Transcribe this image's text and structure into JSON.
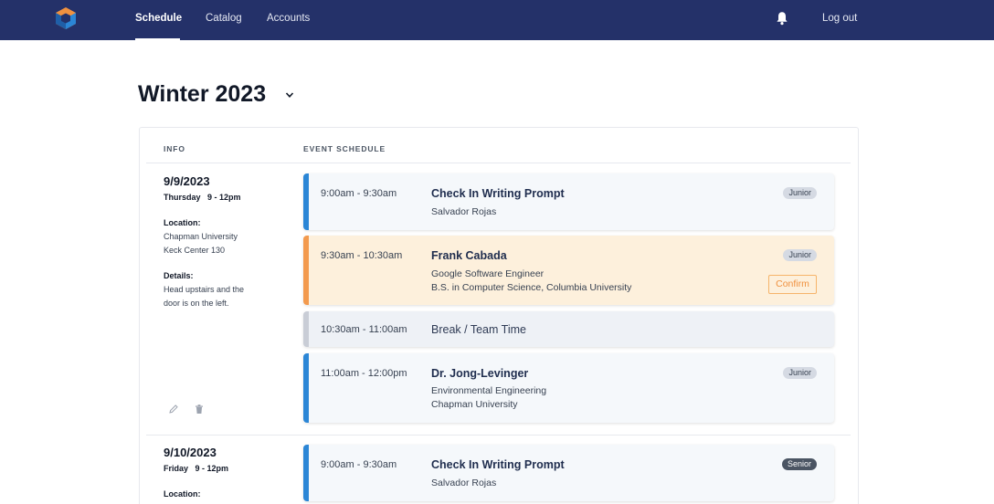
{
  "nav": {
    "logo": "cube-logo",
    "links": [
      "Schedule",
      "Catalog",
      "Accounts"
    ],
    "active": "Schedule",
    "logout": "Log out"
  },
  "title": "Winter 2023",
  "columns": {
    "info": "INFO",
    "schedule": "EVENT SCHEDULE"
  },
  "days": [
    {
      "date": "9/9/2023",
      "weekday_time": "Thursday   9 - 12pm",
      "location_label": "Location:",
      "location_lines": [
        "Chapman University",
        "Keck Center 130"
      ],
      "details_label": "Details:",
      "details_lines": [
        "Head upstairs and the",
        "door is on the left."
      ],
      "events": [
        {
          "time": "9:00am - 9:30am",
          "title": "Check In Writing Prompt",
          "lines": [
            "Salvador Rojas"
          ],
          "badge": "Junior"
        },
        {
          "time": "9:30am - 10:30am",
          "title": "Frank Cabada",
          "lines": [
            "Google Software Engineer",
            "B.S. in Computer Science, Columbia University"
          ],
          "badge": "Junior",
          "action": "Confirm"
        },
        {
          "time": "10:30am - 11:00am",
          "title": "Break / Team Time"
        },
        {
          "time": "11:00am - 12:00pm",
          "title": "Dr. Jong-Levinger",
          "lines": [
            "Environmental Engineering",
            "Chapman University"
          ],
          "badge": "Junior"
        }
      ]
    },
    {
      "date": "9/10/2023",
      "weekday_time": "Friday   9 - 12pm",
      "location_label": "Location:",
      "events": [
        {
          "time": "9:00am - 9:30am",
          "title": "Check In Writing Prompt",
          "lines": [
            "Salvador Rojas"
          ],
          "badge": "Senior"
        }
      ]
    }
  ],
  "colors": {
    "nav_bg": "#243169",
    "accent_blue": "#2b86d6",
    "accent_orange": "#f39a4e",
    "highlight_bg": "#fdf0dc",
    "break_bar": "#c9cdd6"
  },
  "icons": [
    "bell-icon",
    "chevron-down-icon",
    "pencil-icon",
    "trash-icon"
  ]
}
